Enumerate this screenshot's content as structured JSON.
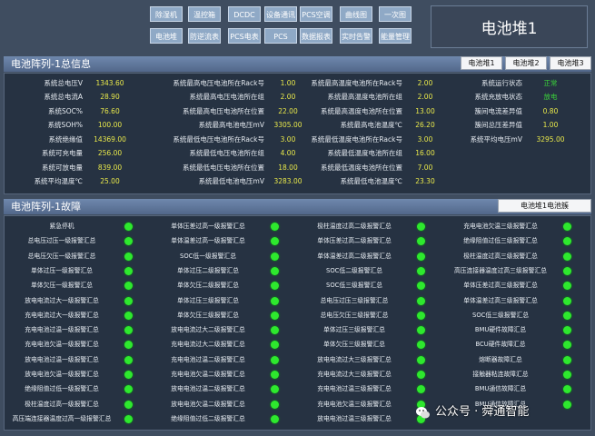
{
  "nav": {
    "buttons": [
      {
        "label": "除湿机"
      },
      {
        "label": "温控箱"
      },
      {
        "label": "DCDC"
      },
      {
        "label": "设备通讯"
      },
      {
        "label": "PCS空调"
      },
      {
        "label": "曲线图"
      },
      {
        "label": "一次图"
      },
      {
        "label": "电池堆"
      },
      {
        "label": "防逆流表"
      },
      {
        "label": "PCS电表"
      },
      {
        "label": "PCS"
      },
      {
        "label": "数据报表"
      },
      {
        "label": "实时告警"
      },
      {
        "label": "能量管理"
      }
    ]
  },
  "title": "电池堆1",
  "summary": {
    "header": "电池阵列-1总信息",
    "tabs": [
      "电池堆1",
      "电池堆2",
      "电池堆3"
    ],
    "col1": [
      {
        "label": "系统总电压V",
        "value": "1343.60"
      },
      {
        "label": "系统总电流A",
        "value": "28.90"
      },
      {
        "label": "系统SOC%",
        "value": "76.60"
      },
      {
        "label": "系统SOH%",
        "value": "100.00"
      },
      {
        "label": "系统绝缘值",
        "value": "14369.00"
      },
      {
        "label": "系统可充电量",
        "value": "256.00"
      },
      {
        "label": "系统可放电量",
        "value": "839.00"
      },
      {
        "label": "系统平均温度℃",
        "value": "25.00"
      }
    ],
    "col2": [
      {
        "label": "系统最高电压电池所在Rack号",
        "value": "1.00"
      },
      {
        "label": "系统最高电压电池所在组",
        "value": "2.00"
      },
      {
        "label": "系统最高电压电池所在位置",
        "value": "22.00"
      },
      {
        "label": "系统最高电池电压mV",
        "value": "3305.00"
      },
      {
        "label": "系统最低电压电池所在Rack号",
        "value": "3.00"
      },
      {
        "label": "系统最低电压电池所在组",
        "value": "4.00"
      },
      {
        "label": "系统最低电压电池所在位置",
        "value": "18.00"
      },
      {
        "label": "系统最低电池电压mV",
        "value": "3283.00"
      }
    ],
    "col3": [
      {
        "label": "系统最高温度电池所在Rack号",
        "value": "2.00"
      },
      {
        "label": "系统最高温度电池所在组",
        "value": "2.00"
      },
      {
        "label": "系统最高温度电池所在位置",
        "value": "13.00"
      },
      {
        "label": "系统最高电池温度℃",
        "value": "26.20"
      },
      {
        "label": "系统最低温度电池所在Rack号",
        "value": "3.00"
      },
      {
        "label": "系统最低温度电池所在组",
        "value": "16.00"
      },
      {
        "label": "系统最低温度电池所在位置",
        "value": "7.00"
      },
      {
        "label": "系统最低电池温度℃",
        "value": "23.30"
      }
    ],
    "col4": [
      {
        "label": "系统运行状态",
        "value": "正常"
      },
      {
        "label": "系统充放电状态",
        "value": "放电"
      },
      {
        "label": "簇间电流差异值",
        "value": "0.80"
      },
      {
        "label": "簇间总压差异值",
        "value": "1.00"
      },
      {
        "label": "系统平均电压mV",
        "value": "3295.00"
      }
    ]
  },
  "faults": {
    "header": "电池阵列-1故障",
    "tab": "电池堆1电池簇",
    "col1": [
      "紧急停机",
      "总电压过压一级报警汇总",
      "总电压欠压一级报警汇总",
      "单体过压一级报警汇总",
      "单体欠压一级报警汇总",
      "放电电流过大一级报警汇总",
      "充电电流过大一级报警汇总",
      "充电电池过温一级报警汇总",
      "充电电池欠温一级报警汇总",
      "放电电池过温一级报警汇总",
      "放电电池欠温一级报警汇总",
      "绝缘阻值过低一级报警汇总",
      "极柱温度过高一级报警汇总",
      "高压端连接器温度过高一级报警汇总"
    ],
    "col2": [
      "单体压差过高一级报警汇总",
      "单体温差过高一级报警汇总",
      "SOC低一级报警汇总",
      "单体过压二级报警汇总",
      "单体欠压二级报警汇总",
      "单体过压三级报警汇总",
      "单体欠压三级报警汇总",
      "放电电流过大二级报警汇总",
      "充电电流过大二级报警汇总",
      "充电电池过温二级报警汇总",
      "充电电池欠温二级报警汇总",
      "放电电池过温二级报警汇总",
      "放电电池欠温二级报警汇总",
      "绝缘阻值过低二级报警汇总"
    ],
    "col3": [
      "极柱温度过高二级报警汇总",
      "单体压差过高二级报警汇总",
      "单体温差过高二级报警汇总",
      "SOC低二级报警汇总",
      "SOC低三级报警汇总",
      "总电压过压三级报警汇总",
      "总电压欠压三级报警汇总",
      "单体过压三级报警汇总",
      "单体欠压三级报警汇总",
      "放电电流过大三级报警汇总",
      "充电电流过大三级报警汇总",
      "充电电池过温三级报警汇总",
      "充电电池欠温三级报警汇总",
      "放电电池过温三级报警汇总"
    ],
    "col4": [
      "充电电池欠温三级报警汇总",
      "绝缘阻值过低三级报警汇总",
      "极柱温度过高三级报警汇总",
      "高压连接器温度过高三级报警汇总",
      "单体压差过高三级报警汇总",
      "单体温差过高三级报警汇总",
      "SOC低三级报警汇总",
      "BMU硬件故障汇总",
      "BCU硬件故障汇总",
      "熔断器故障汇总",
      "接触器粘连故障汇总",
      "BMU通信故障汇总",
      "BMU通信故障汇总",
      ""
    ]
  },
  "watermark": "公众号 · 舜通智能",
  "colors": {
    "value_green": "#2fe02f",
    "value_yellow": "#e8e84a",
    "status_green": "#3ad23a",
    "indicator": "#2ee82e"
  }
}
